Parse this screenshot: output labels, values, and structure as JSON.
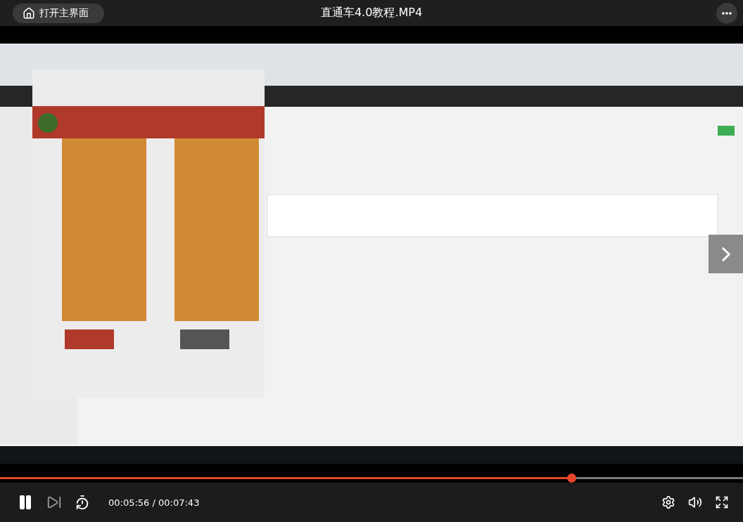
{
  "top_bar": {
    "home_button": "打开主界面",
    "title": "直通车4.0教程.MP4"
  },
  "player": {
    "playing": true,
    "progress": {
      "level": 0.769
    },
    "time": "00:05:56 / 00:07:43"
  }
}
